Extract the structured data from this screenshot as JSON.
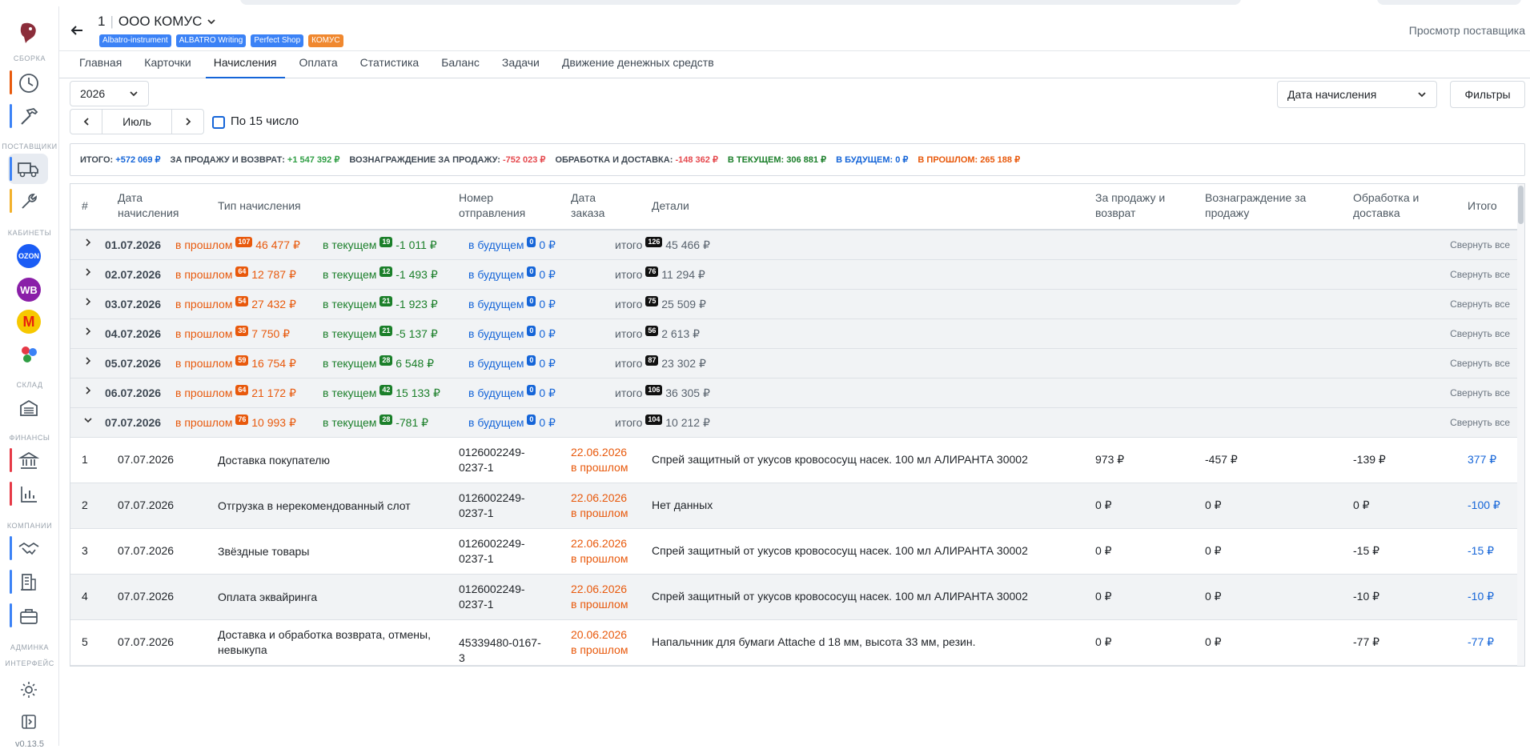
{
  "sidebar": {
    "sections": [
      "СБОРКА",
      "ПОСТАВЩИКИ",
      "КАБИНЕТЫ",
      "СКЛАД",
      "ФИНАНСЫ",
      "КОМПАНИИ",
      "АДМИНКА",
      "ИНТЕРФЕЙС"
    ],
    "marketplaces": [
      "OZON",
      "WB",
      "М"
    ],
    "version": "v0.13.5"
  },
  "header": {
    "number": "1",
    "company": "ООО КОМУС",
    "tags": [
      {
        "label": "Albatro-instrument",
        "color": "#3b82f6"
      },
      {
        "label": "ALBATRO Writing",
        "color": "#3b82f6"
      },
      {
        "label": "Perfect Shop",
        "color": "#3b82f6"
      },
      {
        "label": "КОМУС",
        "color": "#f0882f"
      }
    ],
    "right_link": "Просмотр поставщика"
  },
  "tabs": [
    "Главная",
    "Карточки",
    "Начисления",
    "Оплата",
    "Статистика",
    "Баланс",
    "Задачи",
    "Движение денежных средств"
  ],
  "active_tab": "Начисления",
  "controls": {
    "year": "2026",
    "month": "Июль",
    "checkbox_label": "По 15 число",
    "date_type": "Дата начисления",
    "filters_label": "Фильтры"
  },
  "summary": {
    "total_label": "ИТОГО:",
    "total_value": "+572 069 ₽",
    "sale_label": "ЗА ПРОДАЖУ И ВОЗВРАТ:",
    "sale_value": "+1 547 392 ₽",
    "reward_label": "ВОЗНАГРАЖДЕНИЕ ЗА ПРОДАЖУ:",
    "reward_value": "-752 023 ₽",
    "delivery_label": "ОБРАБОТКА И ДОСТАВКА:",
    "delivery_value": "-148 362 ₽",
    "current": "В ТЕКУЩЕМ: 306 881 ₽",
    "future": "В БУДУЩЕМ: 0 ₽",
    "past": "В ПРОШЛОМ: 265 188 ₽"
  },
  "table": {
    "headers": {
      "num": "#",
      "date": [
        "Дата",
        "начисления"
      ],
      "type": "Тип начисления",
      "shipment": [
        "Номер",
        "отправления"
      ],
      "order_date": [
        "Дата",
        "заказа"
      ],
      "details": "Детали",
      "sale": [
        "За продажу и",
        "возврат"
      ],
      "reward": [
        "Вознаграждение за",
        "продажу"
      ],
      "delivery": [
        "Обработка и",
        "доставка"
      ],
      "total": "Итого"
    },
    "labels": {
      "past": "в прошлом",
      "current": "в текущем",
      "future": "в будущем",
      "total": "итого",
      "collapse": "Свернуть все"
    },
    "groups": [
      {
        "date": "01.07.2026",
        "past_count": "107",
        "past_sum": "46 477 ₽",
        "cur_count": "19",
        "cur_sum": "-1 011 ₽",
        "fut_count": "0",
        "fut_sum": "0 ₽",
        "tot_count": "126",
        "tot_sum": "45 466 ₽",
        "expanded": false
      },
      {
        "date": "02.07.2026",
        "past_count": "64",
        "past_sum": "12 787 ₽",
        "cur_count": "12",
        "cur_sum": "-1 493 ₽",
        "fut_count": "0",
        "fut_sum": "0 ₽",
        "tot_count": "76",
        "tot_sum": "11 294 ₽",
        "expanded": false
      },
      {
        "date": "03.07.2026",
        "past_count": "54",
        "past_sum": "27 432 ₽",
        "cur_count": "21",
        "cur_sum": "-1 923 ₽",
        "fut_count": "0",
        "fut_sum": "0 ₽",
        "tot_count": "75",
        "tot_sum": "25 509 ₽",
        "expanded": false
      },
      {
        "date": "04.07.2026",
        "past_count": "35",
        "past_sum": "7 750 ₽",
        "cur_count": "21",
        "cur_sum": "-5 137 ₽",
        "fut_count": "0",
        "fut_sum": "0 ₽",
        "tot_count": "56",
        "tot_sum": "2 613 ₽",
        "expanded": false
      },
      {
        "date": "05.07.2026",
        "past_count": "59",
        "past_sum": "16 754 ₽",
        "cur_count": "28",
        "cur_sum": "6 548 ₽",
        "fut_count": "0",
        "fut_sum": "0 ₽",
        "tot_count": "87",
        "tot_sum": "23 302 ₽",
        "expanded": false
      },
      {
        "date": "06.07.2026",
        "past_count": "64",
        "past_sum": "21 172 ₽",
        "cur_count": "42",
        "cur_sum": "15 133 ₽",
        "fut_count": "0",
        "fut_sum": "0 ₽",
        "tot_count": "106",
        "tot_sum": "36 305 ₽",
        "expanded": false
      },
      {
        "date": "07.07.2026",
        "past_count": "76",
        "past_sum": "10 993 ₽",
        "cur_count": "28",
        "cur_sum": "-781 ₽",
        "fut_count": "0",
        "fut_sum": "0 ₽",
        "tot_count": "104",
        "tot_sum": "10 212 ₽",
        "expanded": true
      }
    ],
    "rows": [
      {
        "n": "1",
        "date": "07.07.2026",
        "type": "Доставка покупателю",
        "shipment": [
          "0126002249-",
          "0237-1"
        ],
        "order_date": "22.06.2026",
        "order_when": "в прошлом",
        "details": "Спрей защитный от укусов кровососущ насек. 100 мл АЛИРАНТА 30002",
        "sale": "973 ₽",
        "reward": "-457 ₽",
        "delivery": "-139 ₽",
        "total": "377 ₽"
      },
      {
        "n": "2",
        "date": "07.07.2026",
        "type": "Отгрузка в нерекомендованный слот",
        "shipment": [
          "0126002249-",
          "0237-1"
        ],
        "order_date": "22.06.2026",
        "order_when": "в прошлом",
        "details": "Нет данных",
        "sale": "0 ₽",
        "reward": "0 ₽",
        "delivery": "0 ₽",
        "total": "-100 ₽"
      },
      {
        "n": "3",
        "date": "07.07.2026",
        "type": "Звёздные товары",
        "shipment": [
          "0126002249-",
          "0237-1"
        ],
        "order_date": "22.06.2026",
        "order_when": "в прошлом",
        "details": "Спрей защитный от укусов кровососущ насек. 100 мл АЛИРАНТА 30002",
        "sale": "0 ₽",
        "reward": "0 ₽",
        "delivery": "-15 ₽",
        "total": "-15 ₽"
      },
      {
        "n": "4",
        "date": "07.07.2026",
        "type": "Оплата эквайринга",
        "shipment": [
          "0126002249-",
          "0237-1"
        ],
        "order_date": "22.06.2026",
        "order_when": "в прошлом",
        "details": "Спрей защитный от укусов кровососущ насек. 100 мл АЛИРАНТА 30002",
        "sale": "0 ₽",
        "reward": "0 ₽",
        "delivery": "-10 ₽",
        "total": "-10 ₽"
      },
      {
        "n": "5",
        "date": "07.07.2026",
        "type": "Доставка и обработка возврата, отмены, невыкупа",
        "shipment": [
          "45339480-0167-3"
        ],
        "order_date": "20.06.2026",
        "order_when": "в прошлом",
        "details": "Напальчник для бумаги Attache d 18 мм, высота 33 мм, резин.",
        "sale": "0 ₽",
        "reward": "0 ₽",
        "delivery": "-77 ₽",
        "total": "-77 ₽"
      }
    ]
  },
  "colors": {
    "accent": "#1565d8",
    "past": "#e8590c",
    "current": "#1b7f2a",
    "badge_past": "#e8590c",
    "badge_current": "#1b7f2a",
    "badge_future": "#1565d8",
    "badge_total": "#111111"
  }
}
